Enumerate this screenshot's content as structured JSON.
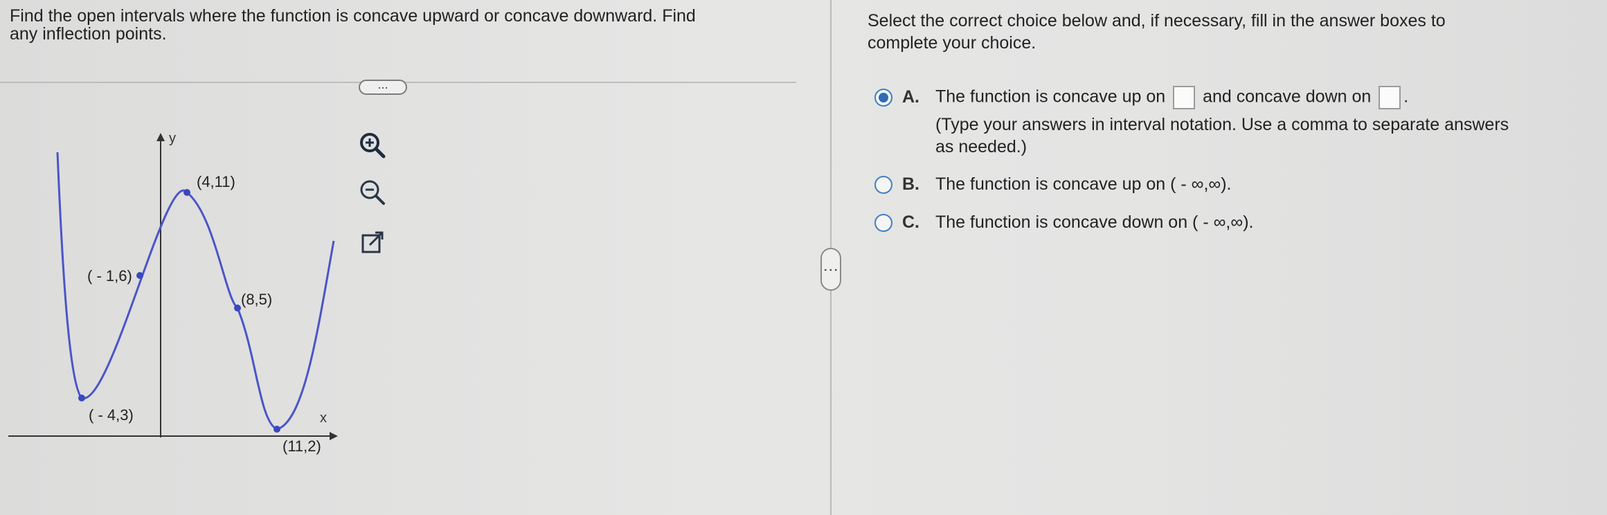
{
  "question": {
    "text_line1": "Find the open intervals where the function is concave upward or concave downward. Find",
    "text_line2": "any inflection points."
  },
  "more_button_label": "...",
  "graph": {
    "y_axis_label": "y",
    "x_axis_label": "x",
    "points": [
      {
        "label": "(4,11)",
        "x": 4,
        "y": 11
      },
      {
        "label": "( - 1,6)",
        "x": -1,
        "y": 6
      },
      {
        "label": "(8,5)",
        "x": 8,
        "y": 5
      },
      {
        "label": "( - 4,3)",
        "x": -4,
        "y": 3
      },
      {
        "label": "(11,2)",
        "x": 11,
        "y": 2
      }
    ],
    "curve_color": "#4a55c8"
  },
  "tools": [
    "zoom-in-icon",
    "zoom-out-icon",
    "open-external-icon"
  ],
  "instructions": {
    "line1": "Select the correct choice below and, if necessary, fill in the answer boxes to",
    "line2": "complete your choice."
  },
  "choices": {
    "a": {
      "letter": "A.",
      "prefix": "The function is concave up on",
      "middle": "and concave down on",
      "suffix": ".",
      "hint_line1": "(Type your answers in interval notation. Use a comma to separate answers",
      "hint_line2": "as needed.)",
      "selected": true
    },
    "b": {
      "letter": "B.",
      "text": "The function is concave up on ( - ∞,∞).",
      "selected": false
    },
    "c": {
      "letter": "C.",
      "text": "The function is concave down on ( - ∞,∞).",
      "selected": false
    }
  },
  "divider_handle_label": "⋮"
}
